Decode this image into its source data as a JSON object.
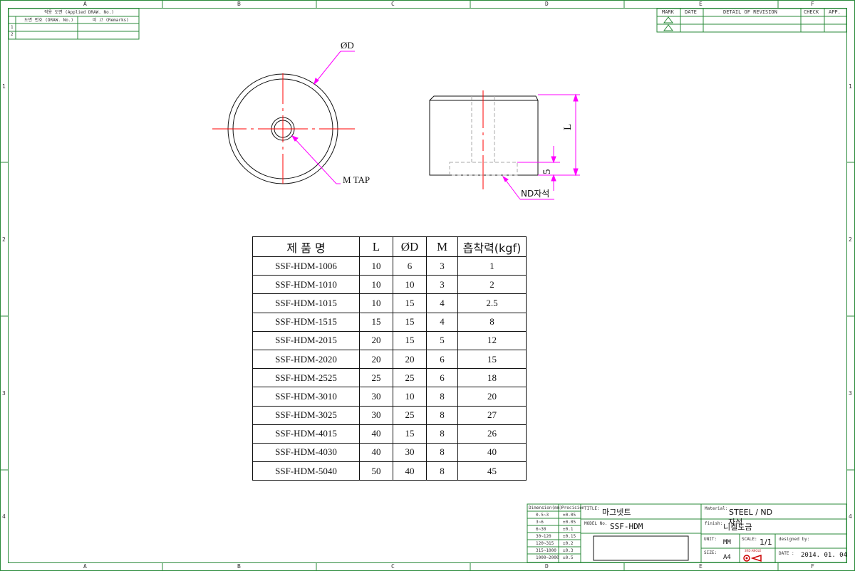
{
  "frame": {
    "columns": [
      "A",
      "B",
      "C",
      "D",
      "E",
      "F"
    ],
    "rows": [
      "1",
      "2",
      "3",
      "4"
    ]
  },
  "applied_block": {
    "header": "적용 도면 (Applied DRAW. No.)",
    "col1": "도면 번호 (DRAW. No.)",
    "col2": "비 고 (Remarks)",
    "rows": [
      "1",
      "2"
    ]
  },
  "revision_block": {
    "mark": "MARK",
    "date": "DATE",
    "detail": "DETAIL OF REVISION",
    "check": "CHECK",
    "app": "APP."
  },
  "drawing": {
    "diameter_label": "ØD",
    "tap_label": "M TAP",
    "length_label": "L",
    "depth_label": "5",
    "magnet_label": "ND자석",
    "accent": "#ff00ff",
    "centerline": "#ff0000"
  },
  "table": {
    "headers": [
      "제 품 명",
      "L",
      "ØD",
      "M",
      "흡착력(kgf)"
    ],
    "rows": [
      [
        "SSF-HDM-1006",
        "10",
        "6",
        "3",
        "1"
      ],
      [
        "SSF-HDM-1010",
        "10",
        "10",
        "3",
        "2"
      ],
      [
        "SSF-HDM-1015",
        "10",
        "15",
        "4",
        "2.5"
      ],
      [
        "SSF-HDM-1515",
        "15",
        "15",
        "4",
        "8"
      ],
      [
        "SSF-HDM-2015",
        "20",
        "15",
        "5",
        "12"
      ],
      [
        "SSF-HDM-2020",
        "20",
        "20",
        "6",
        "15"
      ],
      [
        "SSF-HDM-2525",
        "25",
        "25",
        "6",
        "18"
      ],
      [
        "SSF-HDM-3010",
        "30",
        "10",
        "8",
        "20"
      ],
      [
        "SSF-HDM-3025",
        "30",
        "25",
        "8",
        "27"
      ],
      [
        "SSF-HDM-4015",
        "40",
        "15",
        "8",
        "26"
      ],
      [
        "SSF-HDM-4030",
        "40",
        "30",
        "8",
        "40"
      ],
      [
        "SSF-HDM-5040",
        "50",
        "40",
        "8",
        "45"
      ]
    ]
  },
  "title_block": {
    "tolerance_headers": [
      "Dimension(mm)",
      "Precision"
    ],
    "tolerances": [
      [
        "0.5~3",
        "±0.05"
      ],
      [
        "3~6",
        "±0.05"
      ],
      [
        "6~30",
        "±0.1"
      ],
      [
        "30~120",
        "±0.15"
      ],
      [
        "120~315",
        "±0.2"
      ],
      [
        "315~1000",
        "±0.3"
      ],
      [
        "1000~2000",
        "±0.5"
      ]
    ],
    "title_caption": "TITLE:",
    "title": "마그넷트",
    "model_caption": "MODEL No.",
    "model": "SSF-HDM",
    "material_caption": "Material:",
    "material": "STEEL / ND",
    "finish_caption": "finish:",
    "finish_top": "자석",
    "finish": "니켈도금",
    "unit_caption": "UNIT:",
    "unit": "MM",
    "scale_caption": "SCALE:",
    "scale": "1/1",
    "designed_caption": "designed by:",
    "size_caption": "SIZE:",
    "size": "A4",
    "view_caption": "3RD ANGLE",
    "date_caption": "DATE :",
    "date": "2014. 01. 04"
  }
}
